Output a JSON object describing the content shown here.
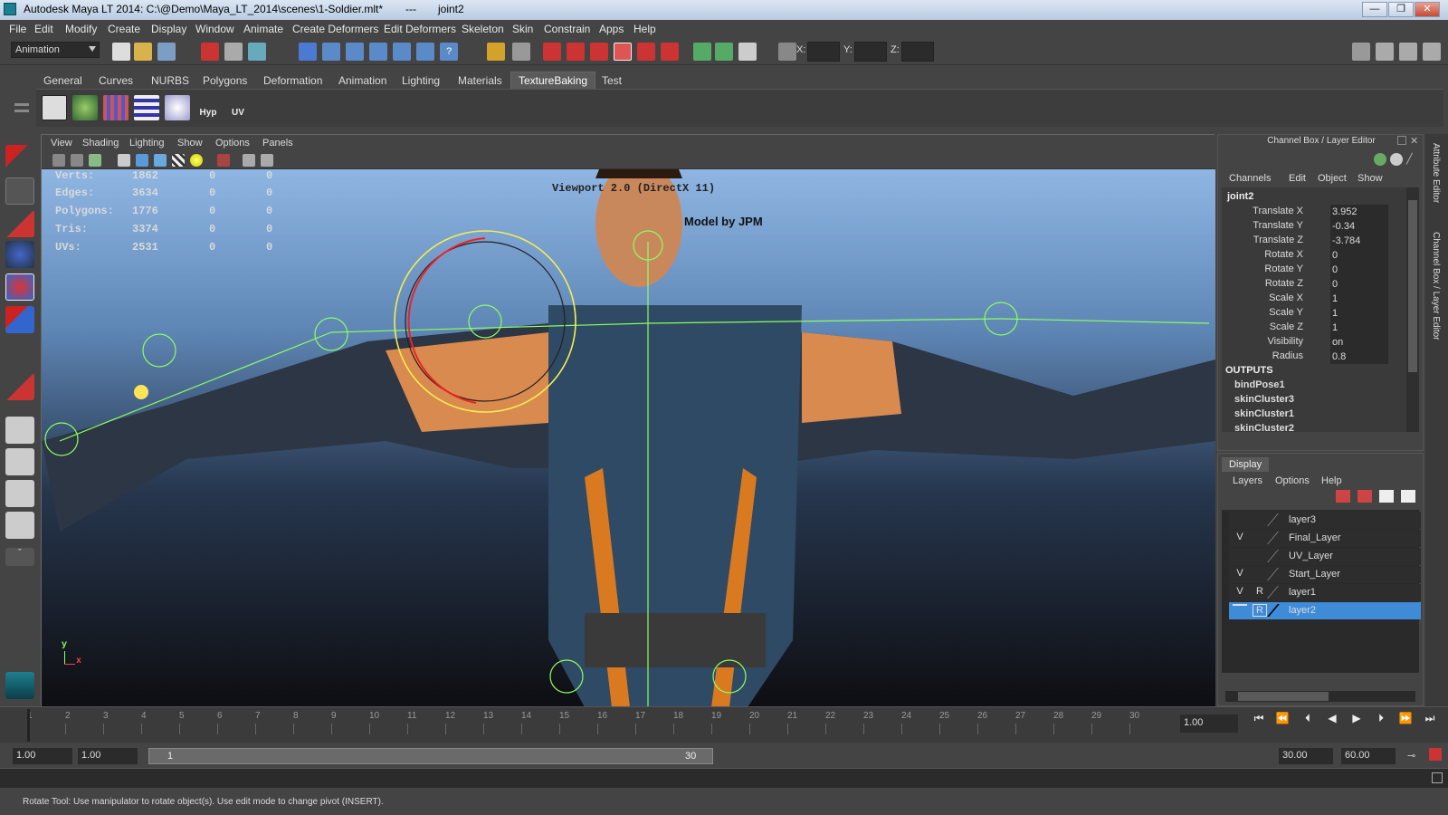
{
  "window": {
    "title": "Autodesk Maya LT 2014: C:\\@Demo\\Maya_LT_2014\\scenes\\1-Soldier.mlt*",
    "separator": "---",
    "selection": "joint2",
    "minimize": "—",
    "restore": "❐",
    "close": "✕"
  },
  "menubar": [
    "File",
    "Edit",
    "Modify",
    "Create",
    "Display",
    "Window",
    "Animate",
    "Create Deformers",
    "Edit Deformers",
    "Skeleton",
    "Skin",
    "Constrain",
    "Apps",
    "Help"
  ],
  "statusline": {
    "mode": "Animation",
    "x_label": "X:",
    "y_label": "Y:",
    "z_label": "Z:"
  },
  "shelf": {
    "tabs": [
      "General",
      "Curves",
      "NURBS",
      "Polygons",
      "Deformation",
      "Animation",
      "Lighting",
      "Materials",
      "TextureBaking",
      "Test"
    ],
    "active_tab": "TextureBaking",
    "text_buttons": [
      "Hyp",
      "UV"
    ]
  },
  "viewport": {
    "menu": [
      "View",
      "Shading",
      "Lighting",
      "Show",
      "Options",
      "Panels"
    ],
    "renderer_label": "Viewport 2.0 (DirectX 11)",
    "credit": "Model by JPM",
    "hud": [
      {
        "label": "Verts:",
        "v1": "1862",
        "v2": "0",
        "v3": "0"
      },
      {
        "label": "Edges:",
        "v1": "3634",
        "v2": "0",
        "v3": "0"
      },
      {
        "label": "Polygons:",
        "v1": "1776",
        "v2": "0",
        "v3": "0"
      },
      {
        "label": "Tris:",
        "v1": "3374",
        "v2": "0",
        "v3": "0"
      },
      {
        "label": "UVs:",
        "v1": "2531",
        "v2": "0",
        "v3": "0"
      }
    ],
    "axis_y": "y",
    "axis_x": "x"
  },
  "channel_box": {
    "title": "Channel Box / Layer Editor",
    "menu": [
      "Channels",
      "Edit",
      "Object",
      "Show"
    ],
    "object": "joint2",
    "attributes": [
      {
        "name": "Translate X",
        "value": "3.952"
      },
      {
        "name": "Translate Y",
        "value": "-0.34"
      },
      {
        "name": "Translate Z",
        "value": "-3.784"
      },
      {
        "name": "Rotate X",
        "value": "0"
      },
      {
        "name": "Rotate Y",
        "value": "0"
      },
      {
        "name": "Rotate Z",
        "value": "0"
      },
      {
        "name": "Scale X",
        "value": "1"
      },
      {
        "name": "Scale Y",
        "value": "1"
      },
      {
        "name": "Scale Z",
        "value": "1"
      },
      {
        "name": "Visibility",
        "value": "on"
      },
      {
        "name": "Radius",
        "value": "0.8"
      }
    ],
    "outputs_header": "OUTPUTS",
    "outputs": [
      "bindPose1",
      "skinCluster3",
      "skinCluster1",
      "skinCluster2"
    ]
  },
  "layer_editor": {
    "tab": "Display",
    "menu": [
      "Layers",
      "Options",
      "Help"
    ],
    "layers": [
      {
        "v": "",
        "r": "",
        "name": "layer3",
        "selected": false
      },
      {
        "v": "V",
        "r": "",
        "name": "Final_Layer",
        "selected": false
      },
      {
        "v": "",
        "r": "",
        "name": "UV_Layer",
        "selected": false
      },
      {
        "v": "V",
        "r": "",
        "name": "Start_Layer",
        "selected": false
      },
      {
        "v": "V",
        "r": "R",
        "name": "layer1",
        "selected": false
      },
      {
        "v": "",
        "r": "R",
        "name": "layer2",
        "selected": true
      }
    ]
  },
  "side_tabs": [
    "Attribute Editor",
    "Channel Box / Layer Editor"
  ],
  "timeslider": {
    "ticks": [
      "1",
      "2",
      "3",
      "4",
      "5",
      "6",
      "7",
      "8",
      "9",
      "10",
      "11",
      "12",
      "13",
      "14",
      "15",
      "16",
      "17",
      "18",
      "19",
      "20",
      "21",
      "22",
      "23",
      "24",
      "25",
      "26",
      "27",
      "28",
      "29",
      "30"
    ],
    "current_frame": "1.00"
  },
  "rangeslider": {
    "start_time": "1.00",
    "range_start": "1.00",
    "slider_start": "1",
    "slider_end": "30",
    "range_end": "30.00",
    "end_time": "60.00"
  },
  "help_line": "Rotate Tool: Use manipulator to rotate object(s). Use edit mode to change pivot (INSERT)."
}
